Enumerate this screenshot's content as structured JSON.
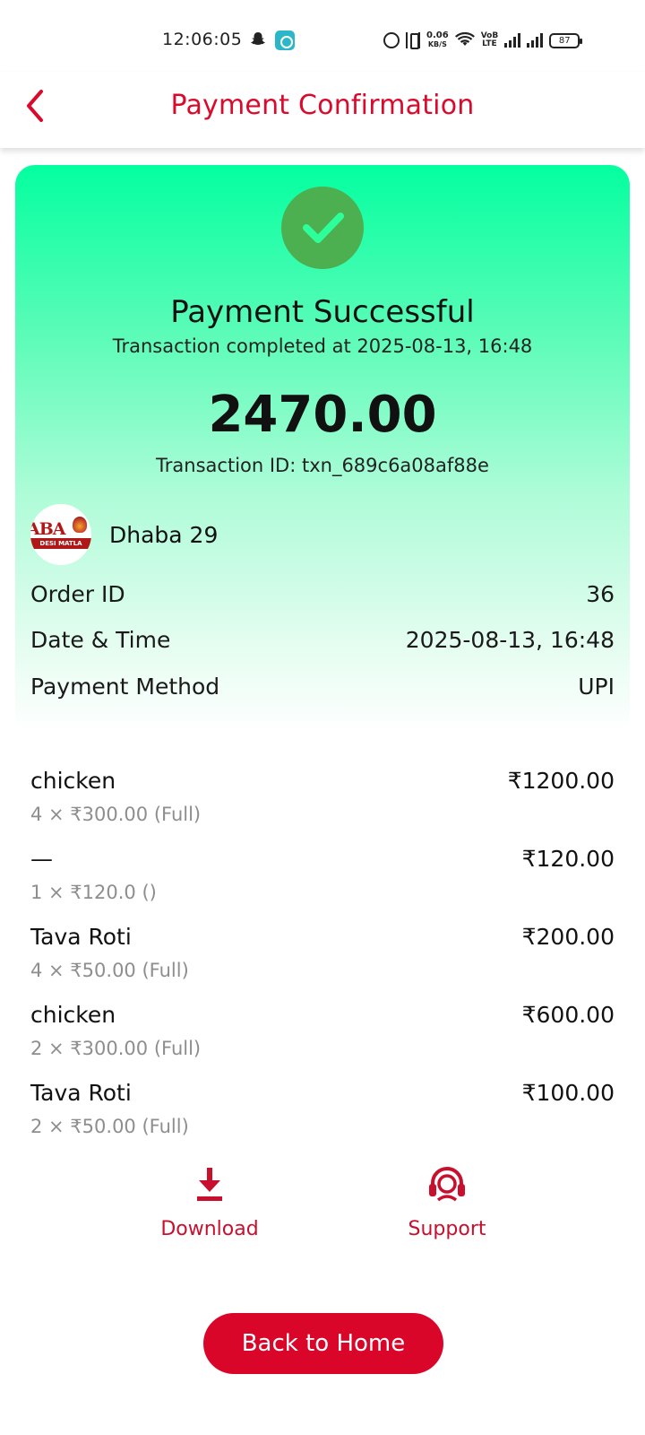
{
  "status_bar": {
    "time": "12:06:05",
    "net_speed_top": "0.06",
    "net_speed_bottom": "KB/S",
    "volte_top": "VoB",
    "volte_bottom": "LTE",
    "battery": "87",
    "icons": [
      "snapchat-icon",
      "message-icon",
      "alarm-icon",
      "vibrate-icon",
      "wifi-icon",
      "signal-icon",
      "battery-icon"
    ]
  },
  "header": {
    "title": "Payment Confirmation",
    "back_icon": "chevron-left-icon"
  },
  "card": {
    "status_title": "Payment Successful",
    "status_sub": "Transaction completed at 2025-08-13, 16:48",
    "amount": "2470.00",
    "transaction_line": "Transaction ID: txn_689c6a08af88e",
    "restaurant": {
      "name": "Dhaba 29",
      "logo_text_main": "ABA",
      "logo_text_band": "DESI MATLA"
    },
    "info_rows": [
      {
        "label": "Order ID",
        "value": "36"
      },
      {
        "label": "Date & Time",
        "value": "2025-08-13, 16:48"
      },
      {
        "label": "Payment Method",
        "value": "UPI"
      }
    ]
  },
  "items": [
    {
      "name": "chicken",
      "detail": "4 × ₹300.00 (Full)",
      "total": "₹1200.00"
    },
    {
      "name": "—",
      "detail": "1 × ₹120.0 ()",
      "total": "₹120.00"
    },
    {
      "name": "Tava Roti",
      "detail": "4 × ₹50.00 (Full)",
      "total": "₹200.00"
    },
    {
      "name": "chicken",
      "detail": "2 × ₹300.00 (Full)",
      "total": "₹600.00"
    },
    {
      "name": "Tava Roti",
      "detail": "2 × ₹50.00 (Full)",
      "total": "₹100.00"
    }
  ],
  "actions": {
    "download_label": "Download",
    "support_label": "Support"
  },
  "home_button_label": "Back to Home",
  "colors": {
    "brand_red": "#d90a2c",
    "success_green": "#4caf50",
    "card_gradient_top": "#04ffa0"
  }
}
